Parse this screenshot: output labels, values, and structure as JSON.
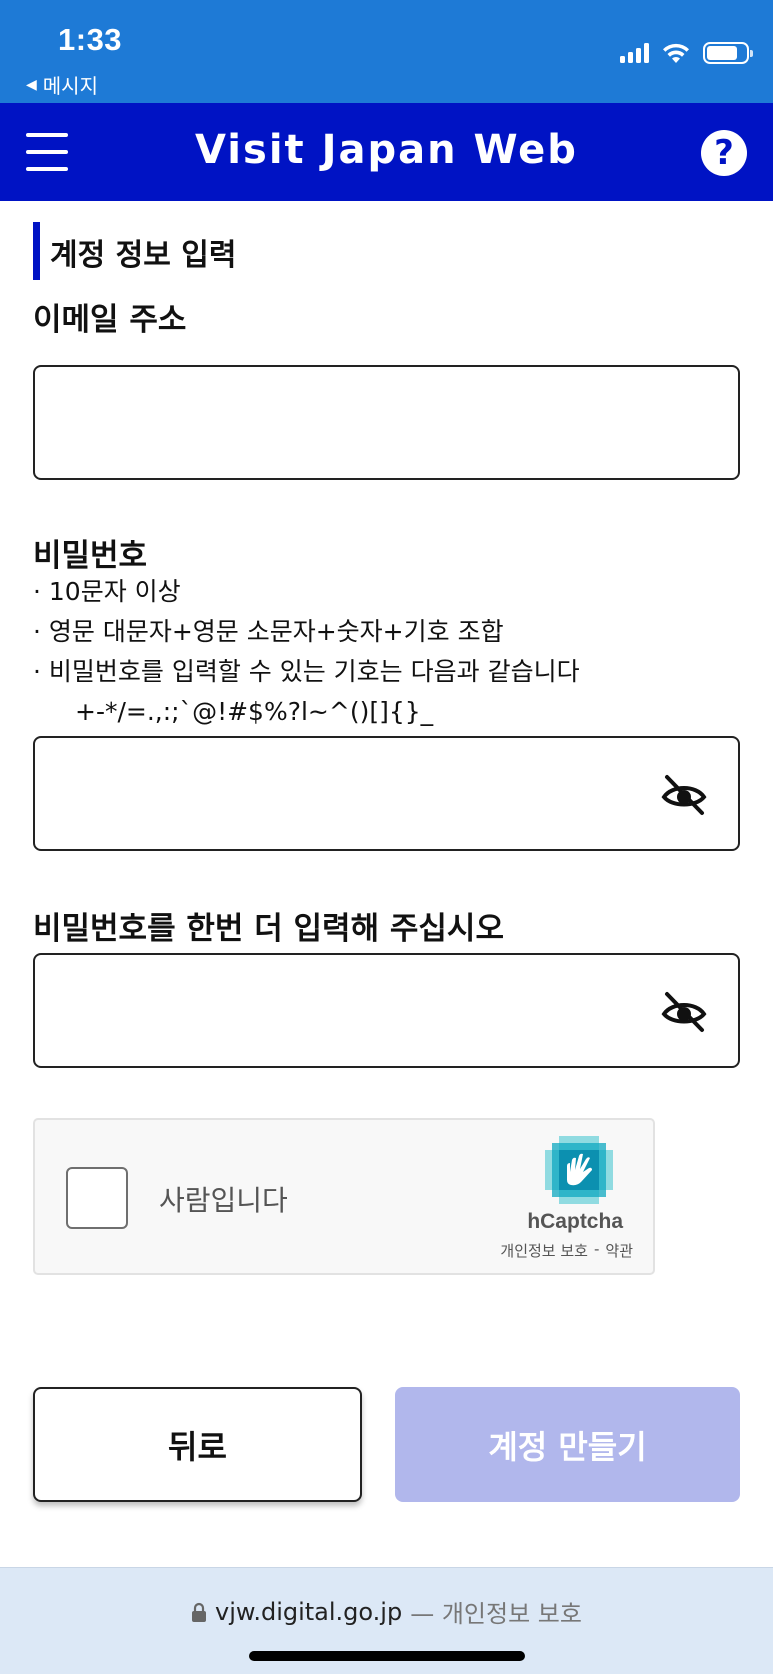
{
  "status_bar": {
    "time": "1:33",
    "back_label": "메시지",
    "back_arrow": "◀"
  },
  "header": {
    "title": "Visit Japan Web",
    "help_symbol": "?",
    "menu_icon": "hamburger-icon",
    "help_icon": "question-circle-icon"
  },
  "form": {
    "section_title": "계정 정보 입력",
    "email": {
      "label": "이메일 주소",
      "value": "",
      "placeholder": ""
    },
    "password": {
      "label": "비밀번호",
      "rules": [
        "· 10문자 이상",
        "· 영문 대문자+영문 소문자+숫자+기호 조합",
        "· 비밀번호를 입력할 수 있는 기호는 다음과 같습니다"
      ],
      "symbols": "+-*/=.,:;`@!#$%?l~^()[]{}_",
      "value": ""
    },
    "password_confirm": {
      "label": "비밀번호를 한번 더 입력해 주십시오",
      "value": ""
    },
    "eye_icon": "eye-slash-icon"
  },
  "captcha": {
    "label": "사람입니다",
    "brand": "hCaptcha",
    "privacy_link": "개인정보 보호",
    "separator": "-",
    "terms_link": "약관",
    "checked": false
  },
  "buttons": {
    "back": "뒤로",
    "create_account": "계정 만들기"
  },
  "browser": {
    "url": "vjw.digital.go.jp",
    "url_note": "— 개인정보 보호"
  },
  "colors": {
    "status_bar": "#1E7AD6",
    "header": "#0013C4",
    "create_button_disabled": "#B1B7EC",
    "safari_bar": "#DCE8F6"
  }
}
